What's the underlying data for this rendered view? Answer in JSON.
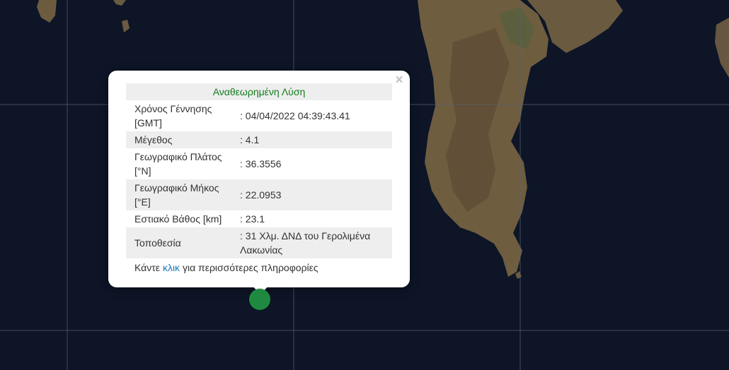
{
  "map": {
    "background": "#0d1527",
    "land_color": "#6b5a3e",
    "grid_color": "#5a6273"
  },
  "popup": {
    "close_symbol": "×",
    "title": "Αναθεωρημένη Λύση",
    "rows": [
      {
        "label_line1": "Χρόνος Γέννησης",
        "label_line2": "[GMT]",
        "value": ": 04/04/2022 04:39:43.41"
      },
      {
        "label_line1": "Μέγεθος",
        "label_line2": "",
        "value": ": 4.1"
      },
      {
        "label_line1": "Γεωγραφικό Πλάτος",
        "label_line2": "[°N]",
        "value": ": 36.3556"
      },
      {
        "label_line1": "Γεωγραφικό Μήκος",
        "label_line2": "[°E]",
        "value": ": 22.0953"
      },
      {
        "label_line1": "Εστιακό Βάθος [km]",
        "label_line2": "",
        "value": ": 23.1"
      },
      {
        "label_line1": "Τοποθεσία",
        "label_line2": "",
        "value": ": 31 Χλμ. ΔΝΔ του Γερολιμένα Λακωνίας"
      }
    ],
    "footer_prefix": "Κάντε",
    "footer_link": "κλικ",
    "footer_suffix": "για περισσότερες πληροφορίες"
  },
  "marker": {
    "color": "#1f8a3f",
    "icon": "earthquake-marker"
  }
}
